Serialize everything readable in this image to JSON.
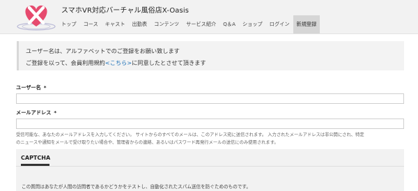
{
  "header": {
    "site_title": "スマホVR対応バーチャル風俗店X-Oasis",
    "nav": [
      {
        "label": "トップ"
      },
      {
        "label": "コース"
      },
      {
        "label": "キャスト"
      },
      {
        "label": "出勤表"
      },
      {
        "label": "コンテンツ"
      },
      {
        "label": "サービス紹介"
      },
      {
        "label": "Q＆A"
      },
      {
        "label": "ショップ"
      },
      {
        "label": "ログイン"
      },
      {
        "label": "新規登録"
      }
    ],
    "active_nav": "新規登録",
    "logo_icon": "heart-x-logo"
  },
  "notice": {
    "line1": "ユーザー名は、アルファベットでのご登録をお願い致します",
    "line2_before": "ご登録を以って、会員利用規約",
    "line2_link": "<こちら>",
    "line2_after": "に同意したとさせて頂きます"
  },
  "form": {
    "username_label": "ユーザー名",
    "username_required": "*",
    "username_value": "",
    "email_label": "メールアドレス",
    "email_required": "*",
    "email_value": "",
    "email_help_1": "受信可能な、あなたのメールアドレスを入力してください。 サイトからのすべてのメールは、このアドレス宛に送信されます。 入力されたメールアドレスは非公開にされ、特定",
    "email_help_2": "のニュースや通知をメールで受け取りたい場合や、管理者からの連絡、あるいはパスワード再発行メールの送信にのみ使用されます。"
  },
  "captcha": {
    "title": "CAPTCHA",
    "description": "この質問はあなたが人間の訪問者であるかどうかをテストし、自動化されたスパム送信を防ぐためのものです。"
  },
  "colors": {
    "link": "#1b6fb7",
    "logo_pink": "#e64a6e",
    "header_bg": "#f2f2f2",
    "active_tab_bg": "#d6d6d6"
  }
}
